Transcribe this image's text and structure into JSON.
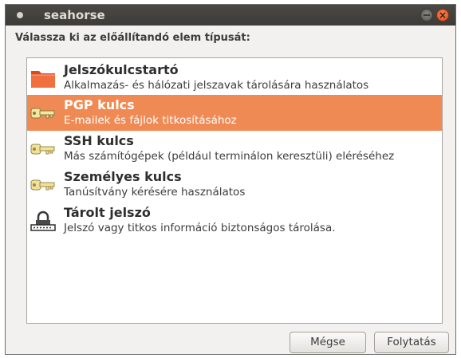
{
  "window": {
    "title": "seahorse",
    "close_glyph": "×"
  },
  "prompt": "Válassza ki az előállítandó elem típusát:",
  "items": [
    {
      "title": "Jelszókulcstartó",
      "description": "Alkalmazás- és hálózati jelszavak tárolására használatos",
      "icon": "folder-icon",
      "selected": false
    },
    {
      "title": "PGP kulcs",
      "description": "E-mailek és fájlok titkosításához",
      "icon": "key-icon",
      "selected": true
    },
    {
      "title": "SSH kulcs",
      "description": "Más számítógépek (például terminálon keresztüli) eléréséhez",
      "icon": "key-icon",
      "selected": false
    },
    {
      "title": "Személyes kulcs",
      "description": "Tanúsítvány kérésére használatos",
      "icon": "key-icon",
      "selected": false
    },
    {
      "title": "Tárolt jelszó",
      "description": "Jelszó vagy titkos információ biztonságos tárolása.",
      "icon": "password-lock-icon",
      "selected": false
    }
  ],
  "buttons": {
    "cancel": "Mégse",
    "continue": "Folytatás"
  },
  "colors": {
    "selection": "#ef8a54",
    "titlebar": "#3c3b37",
    "close_button": "#df4a16"
  }
}
